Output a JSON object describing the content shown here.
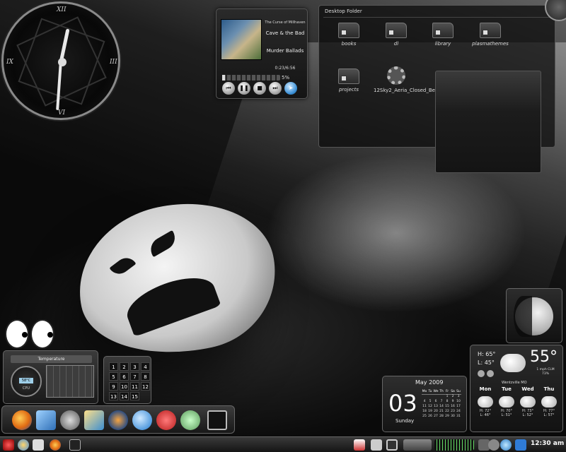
{
  "clock": {
    "numerals": [
      "XII",
      "III",
      "VI",
      "IX"
    ]
  },
  "player": {
    "album": "The Curse of Millhaven",
    "artist": "Cave & the Bad",
    "track": "Murder Ballads",
    "time": "0:23/6:56",
    "volume_label": "5%",
    "volume_fraction": 0.05,
    "buttons": [
      "previous-icon",
      "pause-icon",
      "stop-icon",
      "next-icon",
      "open-icon"
    ]
  },
  "folder": {
    "title": "Desktop Folder",
    "items": [
      {
        "label": "books",
        "icon": "folder-icon"
      },
      {
        "label": "dl",
        "icon": "folder-icon"
      },
      {
        "label": "library",
        "icon": "folder-icon"
      },
      {
        "label": "plasmathemes",
        "icon": "folder-icon"
      },
      {
        "label": "projects",
        "icon": "folder-icon"
      },
      {
        "label": "12Sky2_Aeria_Closed_Be...",
        "icon": "exe-gear-icon"
      }
    ]
  },
  "temperature": {
    "title": "Temperature",
    "lcd": "58°C",
    "label": "CPU"
  },
  "pager": {
    "desktops": [
      "1",
      "2",
      "3",
      "4",
      "5",
      "6",
      "7",
      "8",
      "9",
      "10",
      "11",
      "12",
      "13",
      "14",
      "15"
    ]
  },
  "dock": {
    "apps": [
      "firefox-icon",
      "mail-icon",
      "inkscape-icon",
      "image-viewer-icon",
      "blender-icon",
      "media-player-icon",
      "miro-icon",
      "gimp-hand-icon",
      "terminal-icon"
    ]
  },
  "calendar": {
    "month": "May 2009",
    "day": "03",
    "weekday": "Sunday",
    "headers": [
      "Mo",
      "Tu",
      "We",
      "Th",
      "Fr",
      "Sa",
      "Su"
    ],
    "weeks": [
      [
        "",
        "",
        "",
        "",
        "1",
        "2",
        "3"
      ],
      [
        "4",
        "5",
        "6",
        "7",
        "8",
        "9",
        "10"
      ],
      [
        "11",
        "12",
        "13",
        "14",
        "15",
        "16",
        "17"
      ],
      [
        "18",
        "19",
        "20",
        "21",
        "22",
        "23",
        "24"
      ],
      [
        "25",
        "26",
        "27",
        "28",
        "29",
        "30",
        "31"
      ]
    ]
  },
  "weather": {
    "high": "H: 65°",
    "low": "L: 45°",
    "current": "55°",
    "wind": "1 mph CLM",
    "humidity": "73%",
    "location": "Wentzville MO",
    "forecast": [
      {
        "day": "Mon",
        "high": "H: 72°",
        "low": "L: 46°"
      },
      {
        "day": "Tue",
        "high": "H: 70°",
        "low": "L: 51°"
      },
      {
        "day": "Wed",
        "high": "H: 73°",
        "low": "L: 52°"
      },
      {
        "day": "Thu",
        "high": "H: 77°",
        "low": "L: 57°"
      }
    ]
  },
  "taskbar": {
    "clock": "12:30 am",
    "left_icons": [
      "kde-menu-icon",
      "flower-icon",
      "home-icon",
      "firefox-icon",
      "show-desktop-icon"
    ],
    "right_icons": [
      "network-icon",
      "calculator-icon",
      "monitor-icon",
      "drives-icon",
      "cpu-graph-icon",
      "volume-icon",
      "media-icon",
      "battery-icon",
      "display-icon"
    ]
  }
}
